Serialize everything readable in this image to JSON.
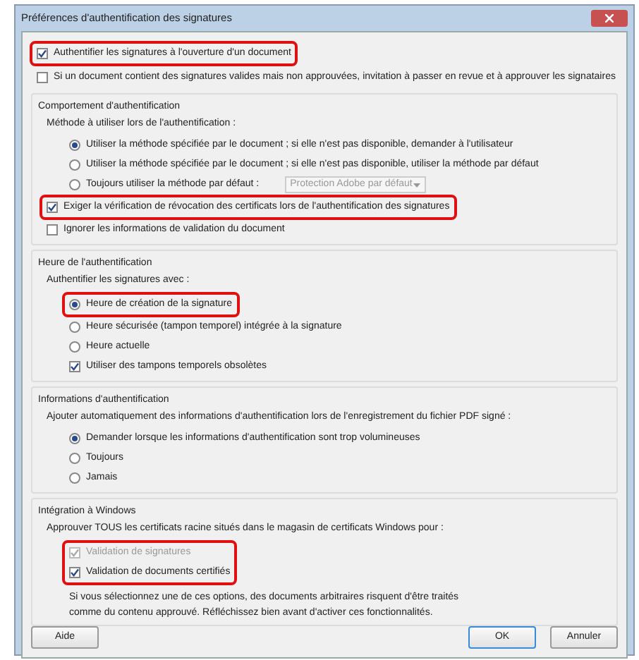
{
  "window": {
    "title": "Préférences d'authentification des signatures"
  },
  "top_options": [
    {
      "kind": "checkbox",
      "label": "Authentifier les signatures à l'ouverture d'un document",
      "checked": true,
      "highlighted": true
    },
    {
      "kind": "checkbox",
      "label": "Si un document contient des signatures valides mais non approuvées, invitation à passer en revue et à approuver les signataires",
      "checked": false,
      "highlighted": false
    }
  ],
  "sections": [
    {
      "title": "Comportement d'authentification",
      "prompt": "Méthode à utiliser lors de l'authentification :",
      "choices": [
        {
          "kind": "radio",
          "label": "Utiliser la méthode spécifiée par le document ; si elle n'est pas disponible, demander à l'utilisateur",
          "selected": true,
          "highlighted": false
        },
        {
          "kind": "radio",
          "label": "Utiliser la méthode spécifiée par le document ; si elle n'est pas disponible, utiliser la méthode par défaut",
          "selected": false,
          "highlighted": false
        },
        {
          "kind": "radio",
          "label": "Toujours utiliser la méthode par défaut :",
          "selected": false,
          "highlighted": false,
          "dropdown": {
            "value": "Protection Adobe par défaut",
            "disabled": true
          }
        }
      ],
      "options": [
        {
          "kind": "checkbox",
          "label": "Exiger la vérification de révocation des certificats lors de l'authentification des signatures",
          "checked": true,
          "highlighted": true
        },
        {
          "kind": "checkbox",
          "label": "Ignorer les informations de validation du document",
          "checked": false,
          "highlighted": false
        }
      ]
    },
    {
      "title": "Heure de l'authentification",
      "prompt": "Authentifier les signatures avec :",
      "choices": [
        {
          "kind": "radio",
          "label": "Heure de création de la signature",
          "selected": true,
          "highlighted": true
        },
        {
          "kind": "radio",
          "label": "Heure sécurisée (tampon temporel) intégrée à la signature",
          "selected": false,
          "highlighted": false
        },
        {
          "kind": "radio",
          "label": "Heure actuelle",
          "selected": false,
          "highlighted": false
        },
        {
          "kind": "checkbox",
          "label": "Utiliser des tampons temporels obsolètes",
          "checked": true,
          "highlighted": false
        }
      ]
    },
    {
      "title": "Informations d'authentification",
      "prompt": "Ajouter automatiquement des informations d'authentification lors de l'enregistrement du fichier PDF signé :",
      "choices": [
        {
          "kind": "radio",
          "label": "Demander lorsque les informations d'authentification sont trop volumineuses",
          "selected": true,
          "highlighted": false
        },
        {
          "kind": "radio",
          "label": "Toujours",
          "selected": false,
          "highlighted": false
        },
        {
          "kind": "radio",
          "label": "Jamais",
          "selected": false,
          "highlighted": false
        }
      ]
    },
    {
      "title": "Intégration à Windows",
      "prompt": "Approuver TOUS les certificats racine situés dans le magasin de certificats Windows pour :",
      "choices_highlighted": true,
      "choices": [
        {
          "kind": "checkbox",
          "label": "Validation de signatures",
          "checked": true,
          "disabled": true,
          "highlighted": false
        },
        {
          "kind": "checkbox",
          "label": "Validation de documents certifiés",
          "checked": true,
          "disabled": false,
          "highlighted": false
        }
      ],
      "note": "Si vous sélectionnez une de ces options, des documents arbitraires risquent d'être traités comme du contenu approuvé. Réfléchissez bien avant d'activer ces fonctionnalités."
    }
  ],
  "left_buttons": [
    {
      "label": "Aide",
      "default": false
    }
  ],
  "right_buttons": [
    {
      "label": "OK",
      "default": true
    },
    {
      "label": "Annuler",
      "default": false
    }
  ]
}
